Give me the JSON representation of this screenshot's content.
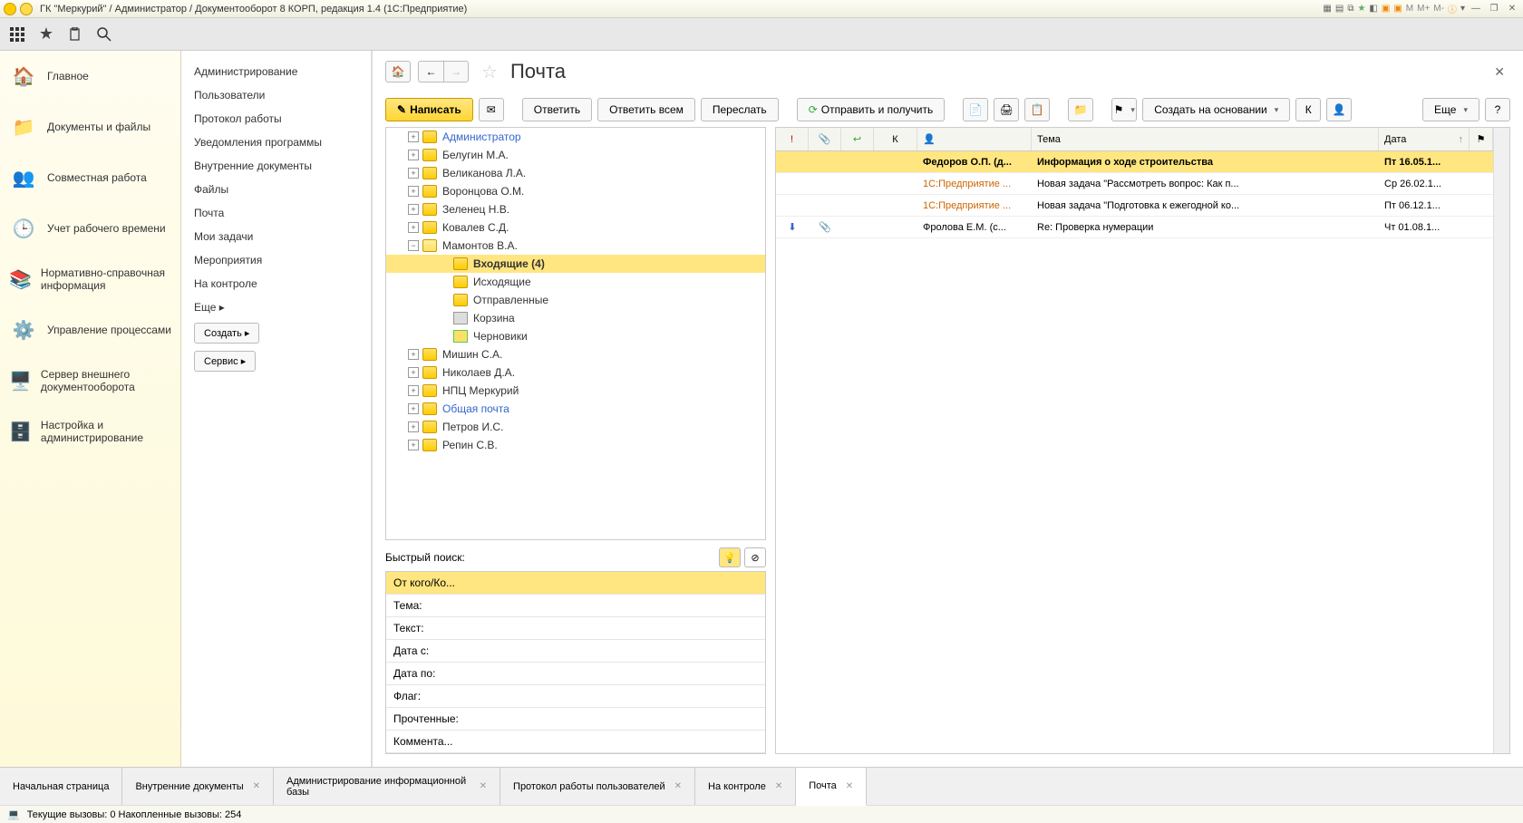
{
  "titlebar": {
    "title": "ГК \"Меркурий\" / Администратор / Документооборот 8 КОРП, редакция 1.4  (1С:Предприятие)",
    "m": "M",
    "mplus": "M+",
    "mminus": "M-"
  },
  "leftnav": [
    {
      "label": "Главное"
    },
    {
      "label": "Документы и файлы"
    },
    {
      "label": "Совместная работа"
    },
    {
      "label": "Учет рабочего времени"
    },
    {
      "label": "Нормативно-справочная информация"
    },
    {
      "label": "Управление процессами"
    },
    {
      "label": "Сервер внешнего документооборота"
    },
    {
      "label": "Настройка и администрирование"
    }
  ],
  "submenu": {
    "items": [
      "Администрирование",
      "Пользователи",
      "Протокол работы",
      "Уведомления программы",
      "Внутренние документы",
      "Файлы",
      "Почта",
      "Мои задачи",
      "Мероприятия",
      "На контроле",
      "Еще ▸"
    ],
    "btn_create": "Создать ▸",
    "btn_service": "Сервис ▸"
  },
  "page": {
    "title": "Почта"
  },
  "toolbar": {
    "write": "Написать",
    "reply": "Ответить",
    "reply_all": "Ответить всем",
    "forward": "Переслать",
    "send_receive": "Отправить и получить",
    "create_based": "Создать на основании",
    "k": "К",
    "more": "Еще"
  },
  "tree": [
    {
      "label": "Администратор",
      "depth": 1,
      "toggle": "+",
      "link": true
    },
    {
      "label": "Белугин М.А.",
      "depth": 1,
      "toggle": "+"
    },
    {
      "label": "Великанова Л.А.",
      "depth": 1,
      "toggle": "+"
    },
    {
      "label": "Воронцова О.М.",
      "depth": 1,
      "toggle": "+"
    },
    {
      "label": "Зеленец Н.В.",
      "depth": 1,
      "toggle": "+"
    },
    {
      "label": "Ковалев С.Д.",
      "depth": 1,
      "toggle": "+"
    },
    {
      "label": "Мамонтов В.А.",
      "depth": 1,
      "toggle": "−",
      "open": true
    },
    {
      "label": "Входящие (4)",
      "depth": 2,
      "toggle": "",
      "selected": true,
      "bold": true
    },
    {
      "label": "Исходящие",
      "depth": 2,
      "toggle": ""
    },
    {
      "label": "Отправленные",
      "depth": 2,
      "toggle": ""
    },
    {
      "label": "Корзина",
      "depth": 2,
      "toggle": "",
      "trash": true
    },
    {
      "label": "Черновики",
      "depth": 2,
      "toggle": "",
      "draft": true
    },
    {
      "label": "Мишин С.А.",
      "depth": 1,
      "toggle": "+"
    },
    {
      "label": "Николаев Д.А.",
      "depth": 1,
      "toggle": "+"
    },
    {
      "label": "НПЦ Меркурий",
      "depth": 1,
      "toggle": "+"
    },
    {
      "label": "Общая почта",
      "depth": 1,
      "toggle": "+",
      "link": true
    },
    {
      "label": "Петров И.С.",
      "depth": 1,
      "toggle": "+"
    },
    {
      "label": "Репин С.В.",
      "depth": 1,
      "toggle": "+"
    }
  ],
  "quicksearch": {
    "label": "Быстрый поиск:",
    "rows": [
      "От кого/Ко...",
      "Тема:",
      "Текст:",
      "Дата с:",
      "Дата по:",
      "Флаг:",
      "Прочтенные:",
      "Коммента..."
    ]
  },
  "msgheader": {
    "k": "К",
    "subject": "Тема",
    "date": "Дата"
  },
  "messages": [
    {
      "from": "Федоров О.П. (д...",
      "subject": "Информация о ходе строительства",
      "date": "Пт 16.05.1...",
      "selected": true
    },
    {
      "from": "1С:Предприятие ...",
      "subject": "Новая задача \"Рассмотреть вопрос: Как п...",
      "date": "Ср 26.02.1...",
      "special": true
    },
    {
      "from": "1С:Предприятие ...",
      "subject": "Новая задача \"Подготовка к ежегодной ко...",
      "date": "Пт 06.12.1...",
      "special": true
    },
    {
      "from": "Фролова Е.М. (с...",
      "subject": "Re: Проверка нумерации",
      "date": "Чт 01.08.1...",
      "pri": "⬇",
      "att": "📎"
    }
  ],
  "bottomtabs": [
    {
      "label": "Начальная страница"
    },
    {
      "label": "Внутренние документы",
      "close": true
    },
    {
      "label": "Администрирование информационной базы",
      "close": true
    },
    {
      "label": "Протокол работы пользователей",
      "close": true
    },
    {
      "label": "На контроле",
      "close": true
    },
    {
      "label": "Почта",
      "close": true,
      "active": true
    }
  ],
  "status": "Текущие вызовы: 0  Накопленные вызовы: 254"
}
